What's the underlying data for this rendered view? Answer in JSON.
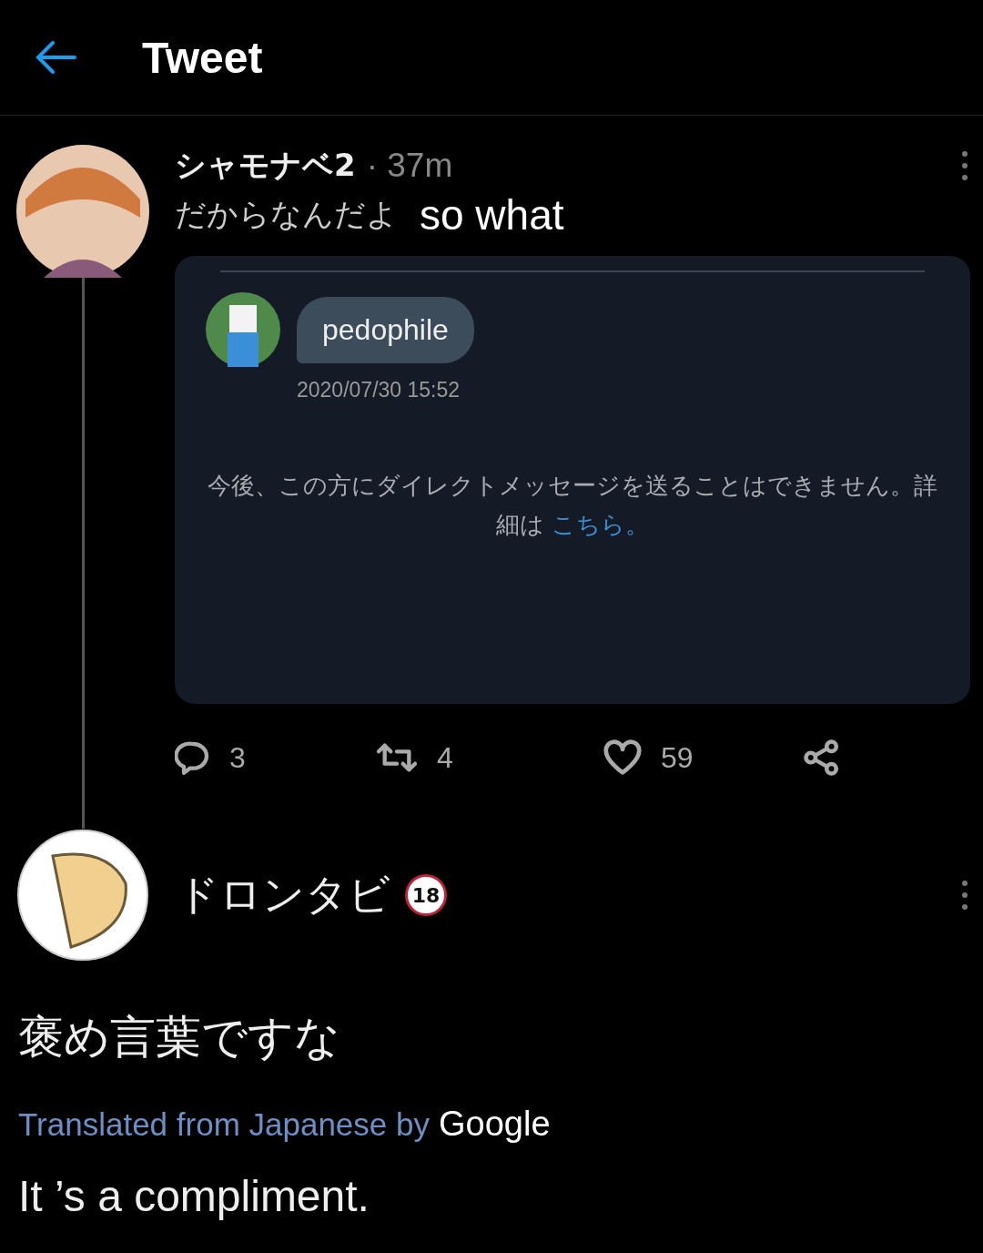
{
  "header": {
    "title": "Tweet"
  },
  "tweet": {
    "name": "シャモナベ2",
    "time": "· 37m",
    "text": "だからなんだよ",
    "overlay_caption": "so what",
    "dm_card": {
      "message": "pedophile",
      "timestamp": "2020/07/30 15:52",
      "notice": "今後、この方にダイレクトメッセージを送ることはできません。詳細は",
      "notice_link": "こちら。"
    },
    "actions": [
      {
        "kind": "reply",
        "count": "3"
      },
      {
        "kind": "retweet",
        "count": "4"
      },
      {
        "kind": "like",
        "count": "59"
      },
      {
        "kind": "share"
      }
    ]
  },
  "reply": {
    "name": "ドロンタビ",
    "badge": "18",
    "text": "褒め言葉ですな",
    "translated_label": "Translated from Japanese by",
    "translator": "Google",
    "translation": "It ’s a compliment."
  }
}
